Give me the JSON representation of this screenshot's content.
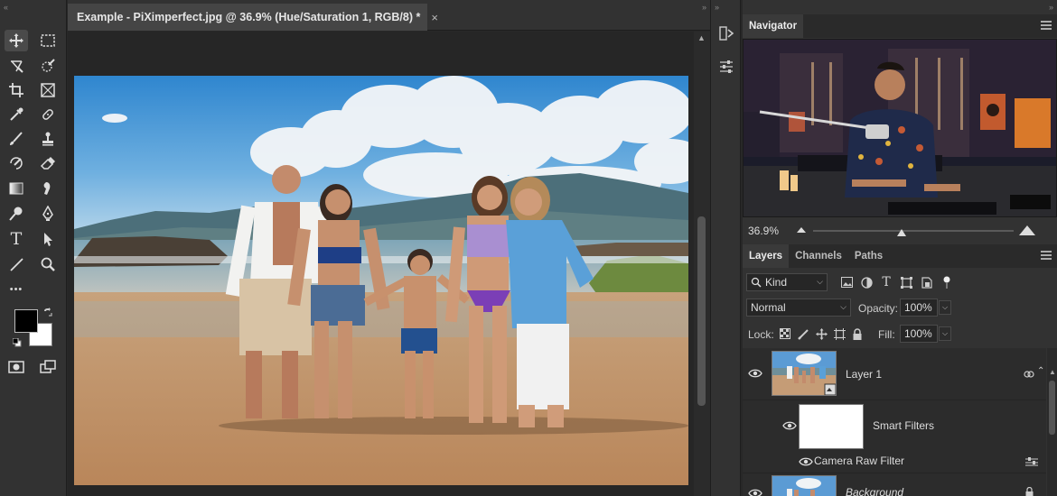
{
  "document": {
    "tab_title": "Example - PiXimperfect.jpg @ 36.9% (Hue/Saturation 1, RGB/8) *",
    "close_glyph": "×"
  },
  "toolbar": {
    "tools": [
      "move-tool",
      "marquee-tool",
      "lasso-tool",
      "quick-selection-tool",
      "crop-tool",
      "frame-tool",
      "eyedropper-tool",
      "spot-healing-tool",
      "brush-tool",
      "clone-stamp-tool",
      "history-brush-tool",
      "eraser-tool",
      "gradient-tool",
      "smudge-tool",
      "dodge-tool",
      "pen-tool",
      "type-tool",
      "path-selection-tool",
      "line-tool",
      "zoom-tool",
      "more-tools",
      "",
      "quick-mask",
      "screen-mode"
    ],
    "type_glyph": "T",
    "more_glyph": "•••",
    "foreground_color": "#000000",
    "background_color": "#ffffff"
  },
  "navigator": {
    "tab_label": "Navigator",
    "zoom_value": "36.9%"
  },
  "layers_panel": {
    "tabs": [
      "Layers",
      "Channels",
      "Paths"
    ],
    "filter_kind": "Kind",
    "blend_mode": "Normal",
    "opacity_label": "Opacity:",
    "opacity_value": "100%",
    "lock_label": "Lock:",
    "fill_label": "Fill:",
    "fill_value": "100%",
    "layers": [
      {
        "name": "Layer 1"
      },
      {
        "name": "Smart Filters"
      },
      {
        "name": "Camera Raw Filter"
      },
      {
        "name": "Background"
      }
    ]
  },
  "colors": {
    "panel_bg": "#323232",
    "canvas_bg": "#262626",
    "accent": "#ffffff"
  }
}
